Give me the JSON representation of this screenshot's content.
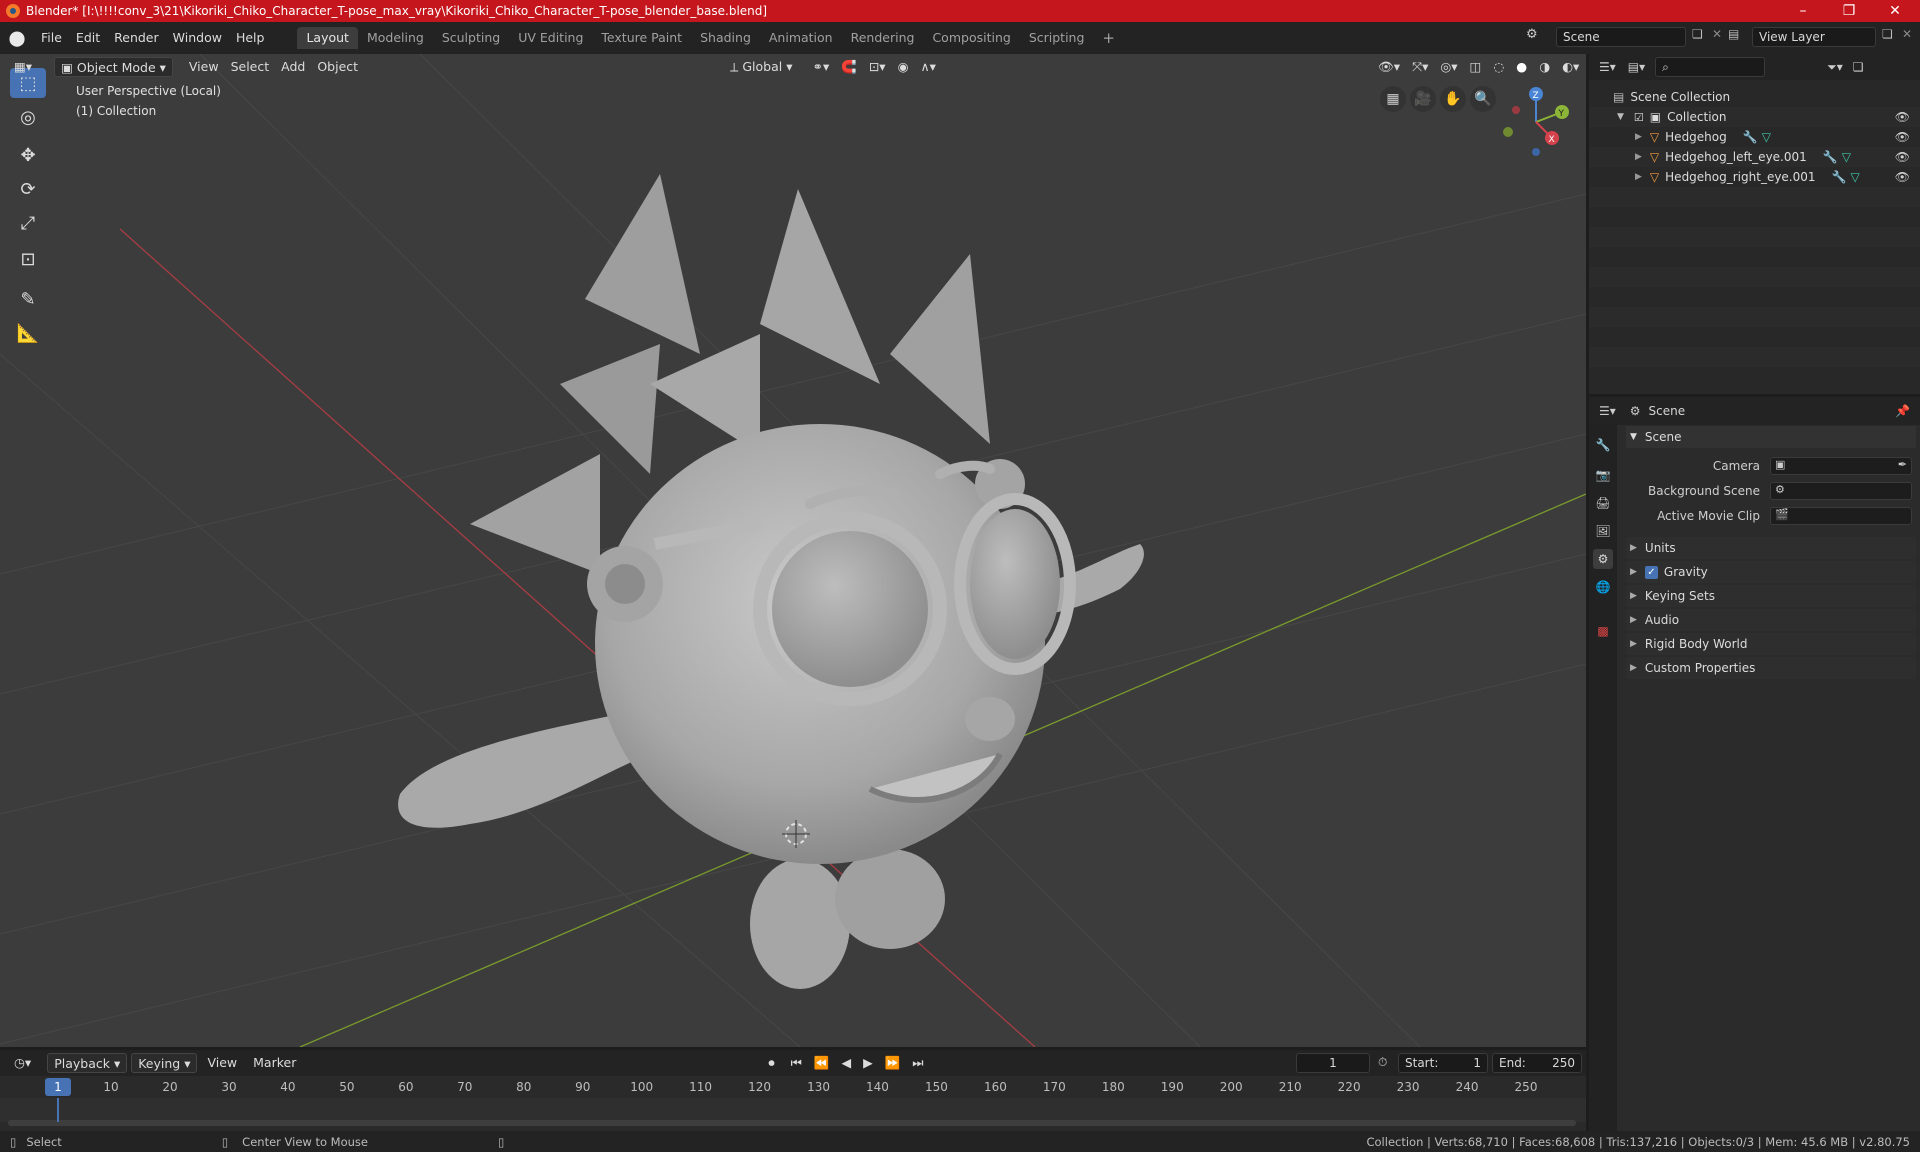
{
  "window": {
    "title": "Blender* [I:\\!!!!conv_3\\21\\Kikoriki_Chiko_Character_T-pose_max_vray\\Kikoriki_Chiko_Character_T-pose_blender_base.blend]",
    "minimize": "–",
    "maximize": "❐",
    "close": "✕"
  },
  "menu": [
    "File",
    "Edit",
    "Render",
    "Window",
    "Help"
  ],
  "workspaces": [
    "Layout",
    "Modeling",
    "Sculpting",
    "UV Editing",
    "Texture Paint",
    "Shading",
    "Animation",
    "Rendering",
    "Compositing",
    "Scripting"
  ],
  "add_workspace": "+",
  "scene_field": "Scene",
  "view_layer_field": "View Layer",
  "viewport": {
    "mode": "Object Mode",
    "menus": [
      "View",
      "Select",
      "Add",
      "Object"
    ],
    "transform_orientation": "Global",
    "perspective_label": "User Perspective (Local)",
    "collection_label": "(1) Collection",
    "gizmo_axes": {
      "x": "X",
      "y": "Y",
      "z": "Z"
    }
  },
  "outliner": {
    "search_placeholder": "",
    "root": "Scene Collection",
    "collection": "Collection",
    "objects": [
      "Hedgehog",
      "Hedgehog_left_eye.001",
      "Hedgehog_right_eye.001"
    ]
  },
  "properties": {
    "header": "Scene",
    "panel_title": "Scene",
    "camera_label": "Camera",
    "background_scene_label": "Background Scene",
    "active_movie_clip_label": "Active Movie Clip",
    "sections": [
      "Units",
      "Gravity",
      "Keying Sets",
      "Audio",
      "Rigid Body World",
      "Custom Properties"
    ],
    "gravity_checked": true
  },
  "timeline": {
    "menus": [
      "Playback",
      "Keying",
      "View",
      "Marker"
    ],
    "current_frame": "1",
    "start_label": "Start:",
    "start_value": "1",
    "end_label": "End:",
    "end_value": "250",
    "ticks": [
      "1",
      "10",
      "20",
      "30",
      "40",
      "50",
      "60",
      "70",
      "80",
      "90",
      "100",
      "110",
      "120",
      "130",
      "140",
      "150",
      "160",
      "170",
      "180",
      "190",
      "200",
      "210",
      "220",
      "230",
      "240",
      "250"
    ]
  },
  "status": {
    "select": "Select",
    "center_view": "Center View to Mouse",
    "stats": "Collection | Verts:68,710 | Faces:68,608 | Tris:137,216 | Objects:0/3 | Mem: 45.6 MB | v2.80.75"
  },
  "colors": {
    "title_bar": "#c4161c",
    "accent_blue": "#4772b3",
    "viewport_bg": "#3c3c3c",
    "axis_x": "#d4424c",
    "axis_y": "#8db537",
    "axis_z": "#4a84d4",
    "mesh_icon": "#f39a3b"
  }
}
